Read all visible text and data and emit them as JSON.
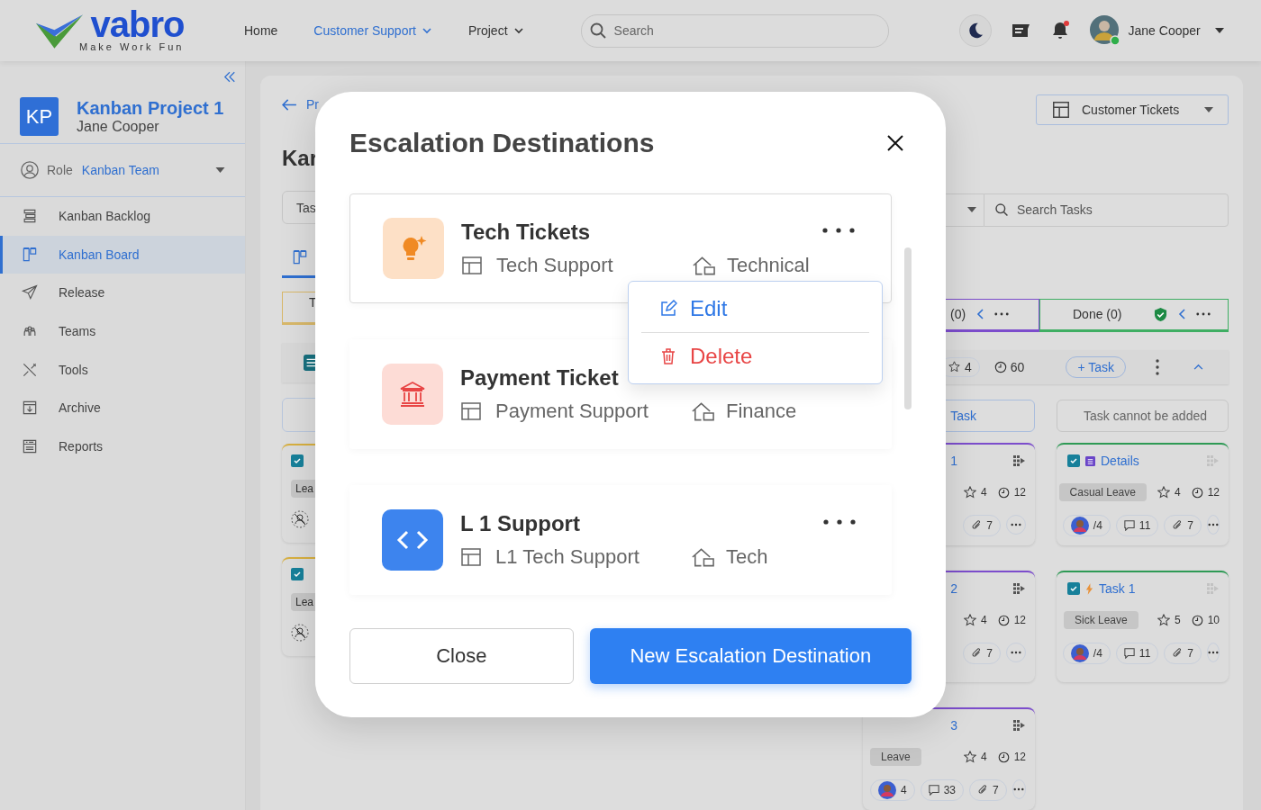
{
  "header": {
    "logo": {
      "wordmark": "vabro",
      "tagline": "Make Work Fun"
    },
    "nav": [
      {
        "label": "Home",
        "selected": false,
        "dropdown": false
      },
      {
        "label": "Customer Support",
        "selected": true,
        "dropdown": true
      },
      {
        "label": "Project",
        "selected": false,
        "dropdown": true
      }
    ],
    "search": {
      "placeholder": "Search"
    },
    "notifications": {
      "unread": true
    },
    "user": {
      "name": "Jane Cooper",
      "online": true
    }
  },
  "sidebar": {
    "project": {
      "initials": "KP",
      "name": "Kanban Project 1",
      "owner": "Jane Cooper"
    },
    "role": {
      "label": "Role",
      "value": "Kanban Team"
    },
    "items": [
      {
        "label": "Kanban Backlog",
        "selected": false
      },
      {
        "label": "Kanban Board",
        "selected": true
      },
      {
        "label": "Release",
        "selected": false
      },
      {
        "label": "Teams",
        "selected": false
      },
      {
        "label": "Tools",
        "selected": false
      },
      {
        "label": "Archive",
        "selected": false
      },
      {
        "label": "Reports",
        "selected": false
      }
    ]
  },
  "board": {
    "back_link": "Pr",
    "title": "Kar",
    "task_field": {
      "placeholder": "Tas"
    },
    "left_column_header": "T",
    "left_tags": [
      "Lea",
      "Lea"
    ],
    "view_selector": {
      "label": "Customer Tickets"
    },
    "search_tasks": {
      "placeholder": "Search Tasks"
    },
    "columns": [
      {
        "label": "(0)",
        "color": "#7c4dcc",
        "done": false
      },
      {
        "label": "Done (0)",
        "color": "#3fae63",
        "done": true
      }
    ],
    "summary": {
      "star_count": "4",
      "time": "60",
      "add_button": "+ Task"
    },
    "add_buttons": [
      {
        "label": "Task",
        "disabled": false
      },
      {
        "label": "Task cannot be added",
        "disabled": true
      }
    ],
    "card_columns": [
      {
        "color": "#7c4dcc",
        "done": false,
        "cards": [
          {
            "title": "1",
            "star_count": "4",
            "time": "12",
            "attachments": "7"
          },
          {
            "title": "2",
            "star_count": "4",
            "time": "12",
            "attachments": "7"
          },
          {
            "title": "3",
            "tag": "Leave",
            "star_count": "4",
            "time": "12",
            "subtasks": "4",
            "comments": "33",
            "attachments": "7"
          }
        ]
      },
      {
        "color": "#2e9a55",
        "done": true,
        "cards": [
          {
            "title": "Details",
            "kind": "details",
            "tag": "Casual Leave",
            "star_count": "4",
            "time": "12",
            "subtasks": "/4",
            "comments": "11",
            "attachments": "7"
          },
          {
            "title": "Task 1",
            "kind": "bolt",
            "tag": "Sick Leave",
            "star_count": "5",
            "time": "10",
            "subtasks": "/4",
            "comments": "11",
            "attachments": "7"
          }
        ]
      }
    ]
  },
  "modal": {
    "title": "Escalation Destinations",
    "destinations": [
      {
        "name": "Tech Tickets",
        "kind": "idea",
        "queue": "Tech Support",
        "category": "Technical",
        "selected": true,
        "menu_open": true
      },
      {
        "name": "Payment Ticket",
        "kind": "bank",
        "queue": "Payment Support",
        "category": "Finance",
        "selected": false,
        "menu_open": false
      },
      {
        "name": "L 1 Support",
        "kind": "code",
        "queue": "L1 Tech Support",
        "category": "Tech",
        "selected": false,
        "menu_open": false
      }
    ],
    "menu": [
      {
        "label": "Edit",
        "kind": "edit"
      },
      {
        "label": "Delete",
        "kind": "delete"
      }
    ],
    "buttons": [
      {
        "label": "Close",
        "kind": "secondary"
      },
      {
        "label": "New Escalation Destination",
        "kind": "primary"
      }
    ]
  }
}
